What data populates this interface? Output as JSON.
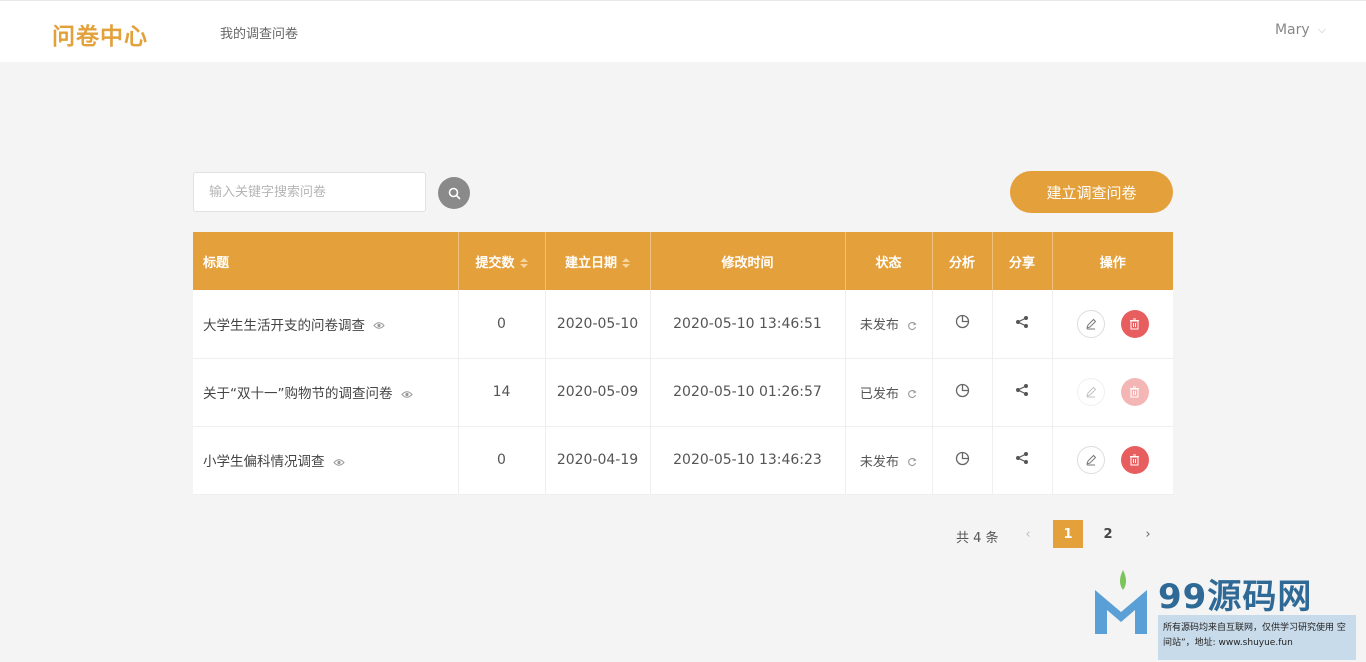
{
  "header": {
    "logo": "问卷中心",
    "nav_link": "我的调查问卷",
    "user_name": "Mary",
    "user_chevron": "⌵"
  },
  "toolbar": {
    "search_placeholder": "输入关键字搜索问卷",
    "create_label": "建立调查问卷"
  },
  "table": {
    "columns": {
      "title": "标题",
      "submissions": "提交数",
      "created": "建立日期",
      "modified": "修改时间",
      "status": "状态",
      "analysis": "分析",
      "share": "分享",
      "actions": "操作"
    },
    "rows": [
      {
        "title": "大学生生活开支的问卷调查",
        "submissions": "0",
        "created": "2020-05-10",
        "modified": "2020-05-10 13:46:51",
        "status": "未发布",
        "actions_enabled": true
      },
      {
        "title": "关于“双十一”购物节的调查问卷",
        "submissions": "14",
        "created": "2020-05-09",
        "modified": "2020-05-10 01:26:57",
        "status": "已发布",
        "actions_enabled": false
      },
      {
        "title": "小学生偏科情况调查",
        "submissions": "0",
        "created": "2020-04-19",
        "modified": "2020-05-10 13:46:23",
        "status": "未发布",
        "actions_enabled": true
      }
    ]
  },
  "pagination": {
    "total": "共 4 条",
    "pages": [
      "1",
      "2"
    ],
    "current": "1",
    "prev": "‹",
    "next": "›"
  },
  "watermark": {
    "brand": "99源码网",
    "note": "所有源码均来自互联网，仅供学习研究使用 空间站”，地址: www.shuyue.fun"
  },
  "colors": {
    "accent": "#e4a03a",
    "delete": "#e85d5d",
    "background": "#f4f4f4"
  },
  "icons": {
    "search": "search-icon",
    "preview": "eye-icon",
    "status_toggle": "refresh-icon",
    "analysis": "pie-chart-icon",
    "share": "share-icon",
    "edit": "pencil-icon",
    "delete": "trash-icon"
  }
}
